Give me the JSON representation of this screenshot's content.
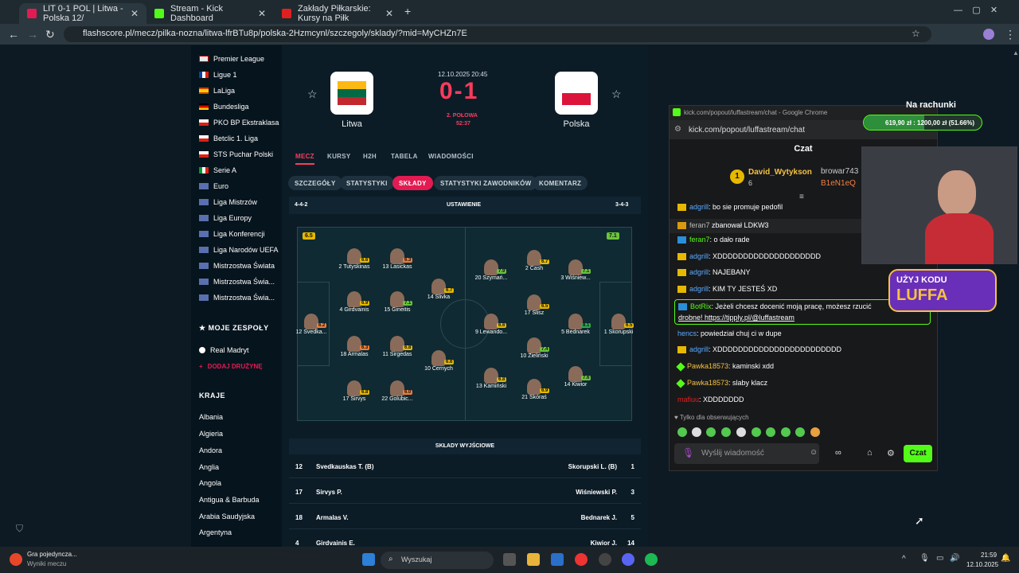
{
  "browser": {
    "tabs": [
      {
        "title": "LIT 0-1 POL | Litwa - Polska 12/"
      },
      {
        "title": "Stream - Kick Dashboard"
      },
      {
        "title": "Zakłady Piłkarskie: Kursy na Piłk"
      }
    ],
    "url": "flashscore.pl/mecz/pilka-nozna/litwa-lfrBTu8p/polska-2Hzmcynl/szczegoly/sklady/?mid=MyCHZn7E"
  },
  "sidebar": {
    "leagues": [
      "Premier League",
      "Ligue 1",
      "LaLiga",
      "Bundesliga",
      "PKO BP Ekstraklasa",
      "Betclic 1. Liga",
      "STS Puchar Polski",
      "Serie A",
      "Euro",
      "Liga Mistrzów",
      "Liga Europy",
      "Liga Konferencji",
      "Liga Narodów UEFA",
      "Mistrzostwa Świata",
      "Mistrzostwa Świa...",
      "Mistrzostwa Świa..."
    ],
    "my_teams_title": "MOJE ZESPOŁY",
    "my_team": "Real Madryt",
    "add_team": "DODAJ DRUŻYNĘ",
    "countries_title": "KRAJE",
    "countries": [
      "Albania",
      "Algieria",
      "Andora",
      "Anglia",
      "Angola",
      "Antigua & Barbuda",
      "Arabia Saudyjska",
      "Argentyna"
    ]
  },
  "match": {
    "date": "12.10.2025 20:45",
    "score": "0-1",
    "status": "2. POŁOWA",
    "time": "52:37",
    "home": "Litwa",
    "away": "Polska"
  },
  "tabs": [
    "MECZ",
    "KURSY",
    "H2H",
    "TABELA",
    "WIADOMOŚCI"
  ],
  "subtabs": [
    "SZCZEGÓŁY",
    "STATYSTYKI",
    "SKŁADY",
    "STATYSTYKI ZAWODNIKÓW",
    "KOMENTARZ"
  ],
  "lineup": {
    "home_formation": "4-4-2",
    "title": "USTAWIENIE",
    "away_formation": "3-4-3",
    "home_rating": "6.5",
    "away_rating": "7.1",
    "starting_title": "SKŁADY WYJŚCIOWE"
  },
  "players": [
    {
      "n": "12 Svedka...",
      "r": "6.2"
    },
    {
      "n": "4 Girdvainis",
      "r": "6.9"
    },
    {
      "n": "15 Gineitis",
      "r": "7.1"
    },
    {
      "n": "2 Tutyskinas",
      "r": "6.6"
    },
    {
      "n": "13 Lasickas",
      "r": "6.3"
    },
    {
      "n": "18 Armalas",
      "r": "6.3"
    },
    {
      "n": "11 Sirgedas",
      "r": "6.8"
    },
    {
      "n": "14 Slivka",
      "r": "6.7"
    },
    {
      "n": "17 Sirvys",
      "r": "6.8"
    },
    {
      "n": "22 Golubic...",
      "r": "6.0"
    },
    {
      "n": "10 Cernych",
      "r": "6.6"
    },
    {
      "n": "1 Skorupski",
      "r": "6.5"
    },
    {
      "n": "5 Bednarek",
      "r": "8.1"
    },
    {
      "n": "3 Wiśniew...",
      "r": "7.1"
    },
    {
      "n": "14 Kiwior",
      "r": "7.6"
    },
    {
      "n": "2 Cash",
      "r": "6.7"
    },
    {
      "n": "17 Slisz",
      "r": "6.5"
    },
    {
      "n": "10 Zieliński",
      "r": "7.4"
    },
    {
      "n": "21 Skóraś",
      "r": "6.9"
    },
    {
      "n": "20 Szymań...",
      "r": "7.9"
    },
    {
      "n": "9 Lewando...",
      "r": "6.6"
    },
    {
      "n": "13 Kamiński",
      "r": "6.8"
    }
  ],
  "rows": [
    {
      "hn": "12",
      "h": "Svedkauskas T. (B)",
      "a": "Skorupski L. (B)",
      "an": "1"
    },
    {
      "hn": "17",
      "h": "Sirvys P.",
      "a": "Wiśniewski P.",
      "an": "3"
    },
    {
      "hn": "18",
      "h": "Armalas V.",
      "a": "Bednarek J.",
      "an": "5"
    },
    {
      "hn": "4",
      "h": "Girdvainis E.",
      "a": "Kiwior J.",
      "an": "14"
    }
  ],
  "chat": {
    "window_url": "kick.com/popout/luffastream/chat - Google Chrome",
    "url": "kick.com/popout/luffastream/chat",
    "title": "Czat",
    "top_user": "David_Wytykson",
    "top_count": "6",
    "user2": "browar743",
    "user3": "B1eN1eQ",
    "messages": [
      {
        "u": "adgrill",
        "t": ": bo sie promuje pedofil"
      },
      {
        "u": "feran7",
        "t": " zbanował LDKW3"
      },
      {
        "u": "feran7",
        "t": ": o dało rade"
      },
      {
        "u": "adgrill",
        "t": ": XDDDDDDDDDDDDDDDDDDDD"
      },
      {
        "u": "adgrill",
        "t": ": NAJEBANY"
      },
      {
        "u": "adgrill",
        "t": ": KIM TY JESTEŚ XD"
      },
      {
        "u": "BotRix",
        "t": ": Jeżeli chcesz docenić moją pracę, możesz rzucić"
      },
      {
        "u": "",
        "t": "drobne! https://tipply.pl/@luffastream"
      },
      {
        "u": "hencs",
        "t": ": powiedział chuj ci w dupe"
      },
      {
        "u": "adgrill",
        "t": ": XDDDDDDDDDDDDDDDDDDDDDDDD"
      },
      {
        "u": "Pawka18573",
        "t": ": kaminski xdd"
      },
      {
        "u": "Pawka18573",
        "t": ": slaby klacz"
      },
      {
        "u": "mafiuu",
        "t": ": XDDDDDDD"
      }
    ],
    "followers_only": "Tylko dla obserwujących",
    "input_placeholder": "Wyślij wiadomość",
    "send": "Czat"
  },
  "overlay": {
    "title": "Na rachunki",
    "progress_text": "619,90 zł : 1200,00 zł (51.66%)",
    "progress": 0.5166,
    "promo1": "UŻYJ KODU",
    "promo2": "LUFFA"
  },
  "taskbar": {
    "app_title": "Gra pojedyncza...",
    "app_sub": "Wyniki meczu",
    "search": "Wyszukaj",
    "time": "21:59",
    "date": "12.10.2025"
  }
}
